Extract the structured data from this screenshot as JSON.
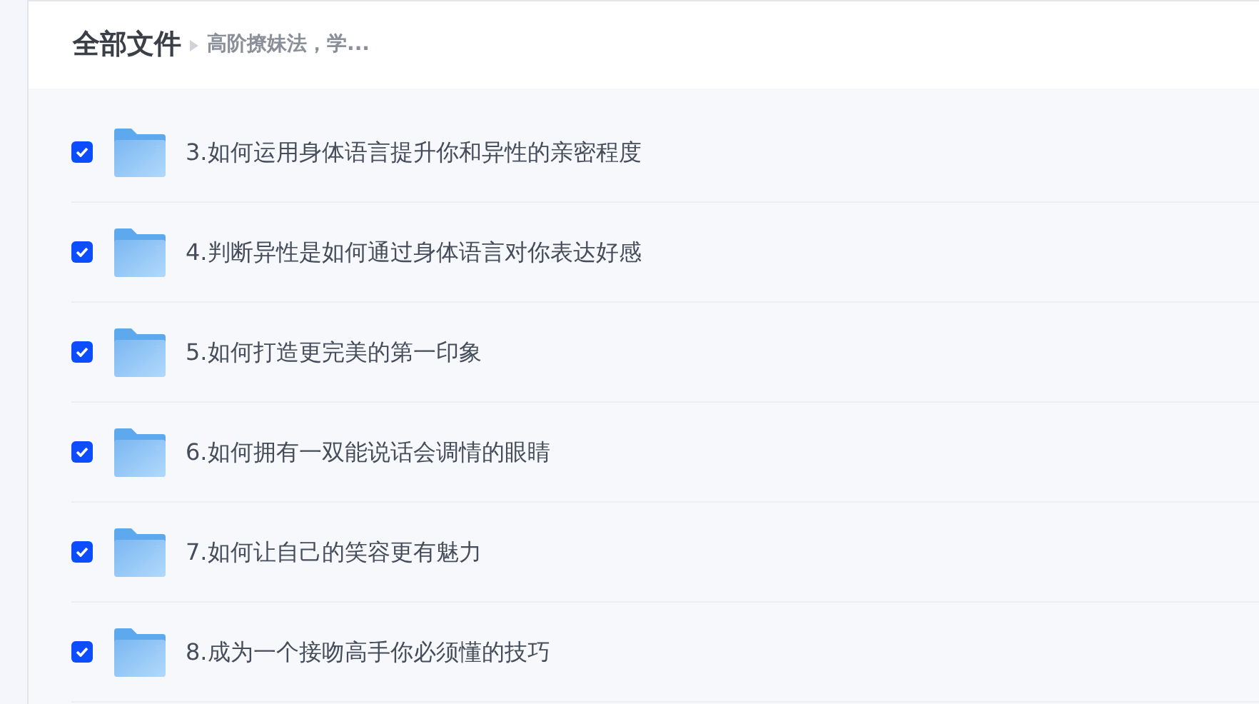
{
  "header": {
    "title": "全部文件",
    "breadcrumb": "高阶撩妹法，学..."
  },
  "files": [
    {
      "name": "3.如何运用身体语言提升你和异性的亲密程度",
      "checked": true
    },
    {
      "name": "4.判断异性是如何通过身体语言对你表达好感",
      "checked": true
    },
    {
      "name": "5.如何打造更完美的第一印象",
      "checked": true
    },
    {
      "name": "6.如何拥有一双能说话会调情的眼睛",
      "checked": true
    },
    {
      "name": "7.如何让自己的笑容更有魅力",
      "checked": true
    },
    {
      "name": "8.成为一个接吻高手你必须懂的技巧",
      "checked": true
    }
  ]
}
